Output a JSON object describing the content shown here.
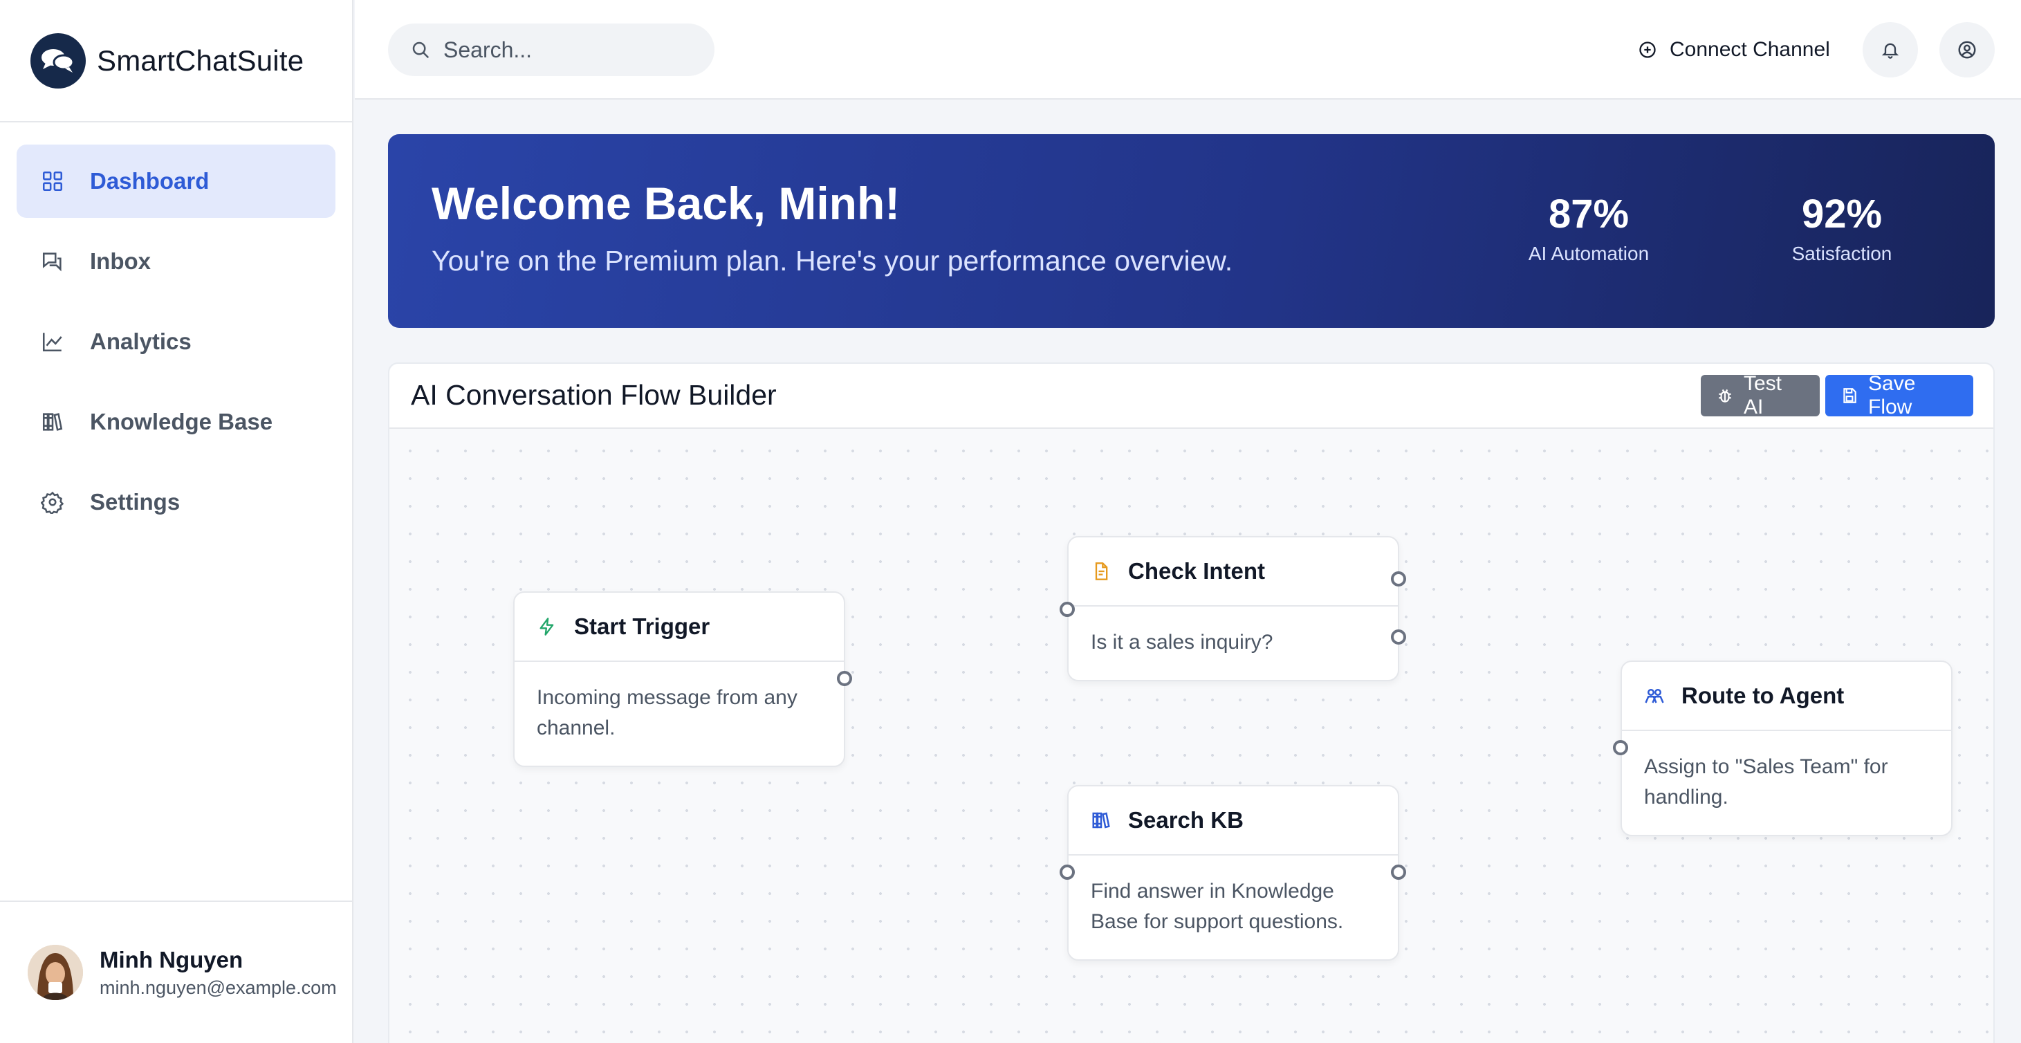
{
  "brand": {
    "name": "SmartChatSuite"
  },
  "sidebar": {
    "items": [
      {
        "label": "Dashboard",
        "icon": "grid-icon",
        "active": true
      },
      {
        "label": "Inbox",
        "icon": "chat-bubbles-icon",
        "active": false
      },
      {
        "label": "Analytics",
        "icon": "line-chart-icon",
        "active": false
      },
      {
        "label": "Knowledge Base",
        "icon": "books-icon",
        "active": false
      },
      {
        "label": "Settings",
        "icon": "gear-icon",
        "active": false
      }
    ],
    "user": {
      "name": "Minh Nguyen",
      "email": "minh.nguyen@example.com"
    }
  },
  "header": {
    "search": {
      "placeholder": "Search..."
    },
    "connect_label": "Connect Channel"
  },
  "banner": {
    "title": "Welcome Back, Minh!",
    "subtitle": "You're on the Premium plan. Here's your performance overview.",
    "stats": [
      {
        "value": "87%",
        "label": "AI Automation"
      },
      {
        "value": "92%",
        "label": "Satisfaction"
      }
    ]
  },
  "flow": {
    "title": "AI Conversation Flow Builder",
    "test_label": "Test AI",
    "save_label": "Save Flow",
    "nodes": [
      {
        "title": "Start Trigger",
        "body": "Incoming message from any channel.",
        "icon": "bolt-icon",
        "icon_color": "#22a66a"
      },
      {
        "title": "Check Intent",
        "body": "Is it a sales inquiry?",
        "icon": "document-icon",
        "icon_color": "#e69a1e"
      },
      {
        "title": "Search KB",
        "body": "Find answer in Knowledge Base for support questions.",
        "icon": "books-icon",
        "icon_color": "#2e5bd6"
      },
      {
        "title": "Route to Agent",
        "body": "Assign to \"Sales Team\" for handling.",
        "icon": "users-icon",
        "icon_color": "#2e5bd6"
      }
    ]
  },
  "colors": {
    "accent": "#2e5bd6",
    "primary_button": "#2f6df0",
    "secondary_button": "#6b7280",
    "banner_start": "#2a44a8",
    "banner_end": "#18245a"
  }
}
